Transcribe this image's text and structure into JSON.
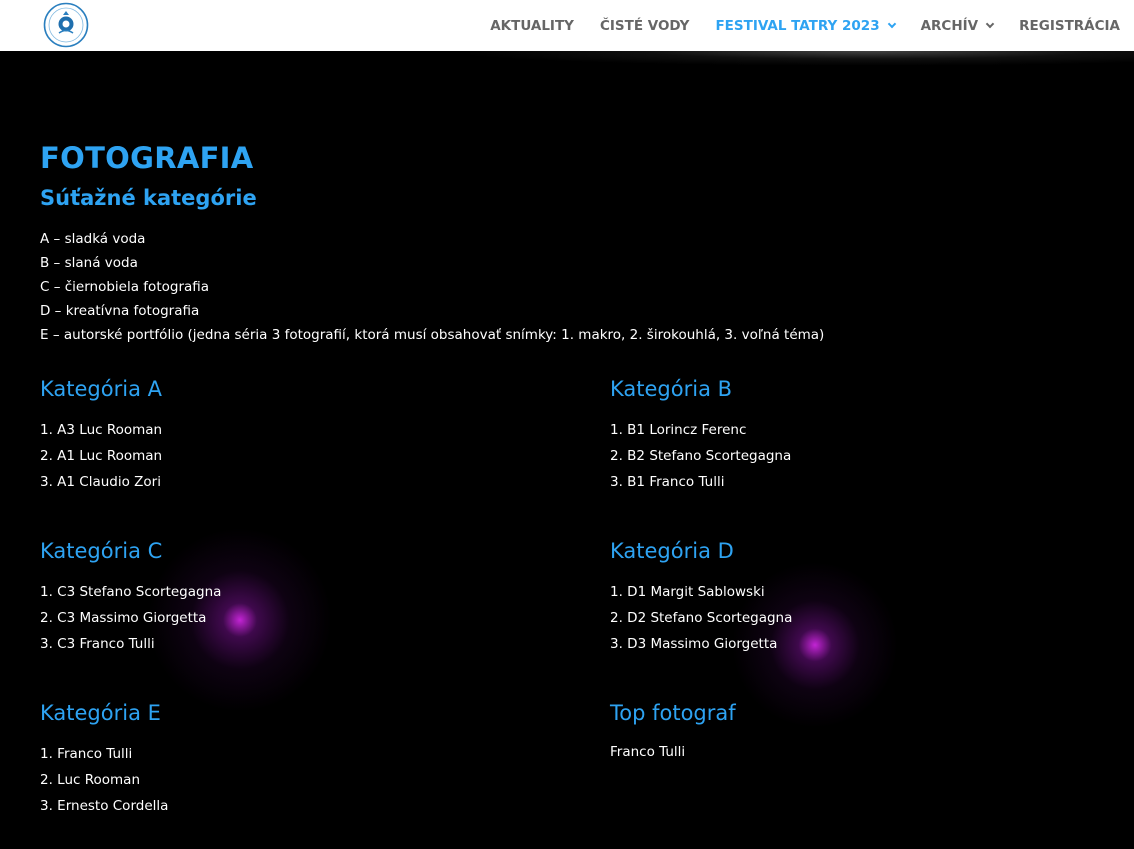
{
  "header": {
    "nav": [
      {
        "label": "AKTUALITY",
        "active": false,
        "has_dropdown": false
      },
      {
        "label": "ČISTÉ VODY",
        "active": false,
        "has_dropdown": false
      },
      {
        "label": "FESTIVAL TATRY 2023",
        "active": true,
        "has_dropdown": true
      },
      {
        "label": "ARCHÍV",
        "active": false,
        "has_dropdown": true
      },
      {
        "label": "REGISTRÁCIA",
        "active": false,
        "has_dropdown": false
      }
    ],
    "accent_color": "#2ea3f2"
  },
  "main": {
    "title": "FOTOGRAFIA",
    "subtitle": "Súťažné kategórie",
    "categories": [
      "A – sladká voda",
      "B – slaná voda",
      "C – čiernobiela fotografia",
      "D – kreatívna fotografia",
      "E – autorské portfólio (jedna séria 3 fotografií, ktorá musí obsahovať snímky: 1. makro, 2. širokouhlá, 3. voľná téma)"
    ],
    "results": {
      "a": {
        "heading": "Kategória A",
        "items": [
          "1. A3 Luc Rooman",
          "2. A1 Luc Rooman",
          "3. A1 Claudio Zori"
        ]
      },
      "b": {
        "heading": "Kategória B",
        "items": [
          "1. B1 Lorincz Ferenc",
          "2. B2 Stefano Scortegagna",
          "3. B1 Franco Tulli"
        ]
      },
      "c": {
        "heading": "Kategória C",
        "items": [
          "1. C3 Stefano Scortegagna",
          "2. C3 Massimo Giorgetta",
          "3. C3 Franco Tulli"
        ]
      },
      "d": {
        "heading": "Kategória D",
        "items": [
          "1. D1 Margit Sablowski",
          "2. D2 Stefano Scortegagna",
          "3. D3 Massimo Giorgetta"
        ]
      },
      "e": {
        "heading": "Kategória E",
        "items": [
          "1. Franco Tulli",
          "2. Luc Rooman",
          "3. Ernesto Cordella"
        ]
      },
      "top": {
        "heading": "Top fotograf",
        "items": [
          "Franco Tulli"
        ]
      }
    }
  }
}
